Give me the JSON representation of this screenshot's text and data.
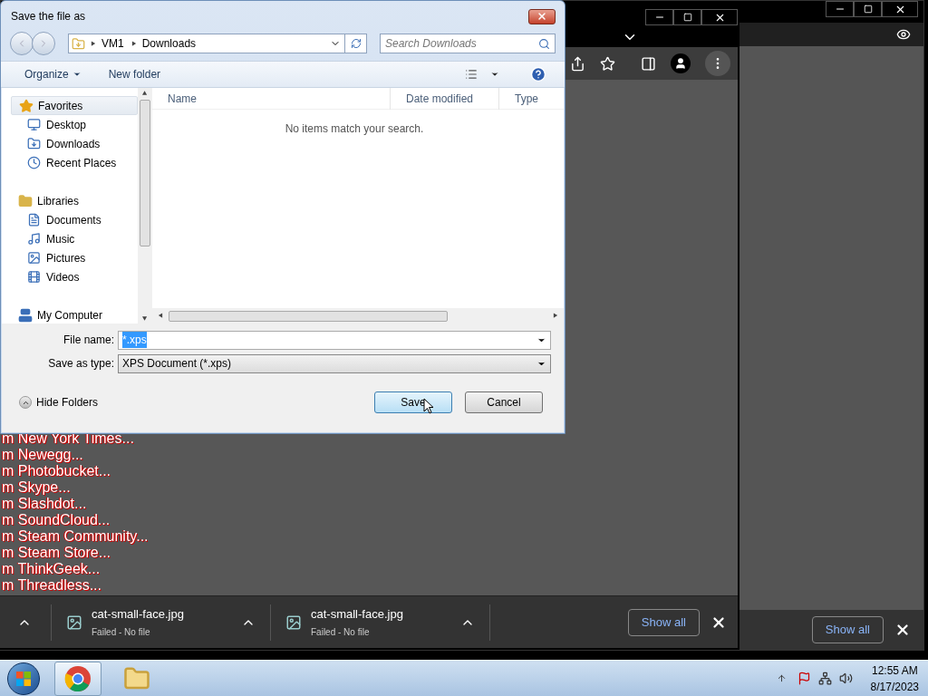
{
  "back_window": {
    "downloads_bar": {
      "show_all": "Show all"
    }
  },
  "front_window": {
    "page_lines": [
      "m New York Times...",
      "m Newegg...",
      "m Photobucket...",
      "m Skype...",
      "m Slashdot...",
      "m SoundCloud...",
      "m Steam Community...",
      "m Steam Store...",
      "m ThinkGeek...",
      "m Threadless..."
    ],
    "downloads": [
      {
        "name": "cat-small-face.jpg",
        "status": "Failed - No file"
      },
      {
        "name": "cat-small-face.jpg",
        "status": "Failed - No file"
      }
    ],
    "show_all": "Show all"
  },
  "dialog": {
    "title": "Save the file as",
    "path": [
      "VM1",
      "Downloads"
    ],
    "search": {
      "placeholder": "Search Downloads"
    },
    "toolbar": [
      "Organize",
      "New folder"
    ],
    "sidebar": [
      {
        "label": "Favorites",
        "selected": true,
        "children": [
          {
            "label": "Desktop"
          },
          {
            "label": "Downloads"
          },
          {
            "label": "Recent Places"
          }
        ]
      },
      {
        "label": "Libraries",
        "selected": false,
        "children": [
          {
            "label": "Documents"
          },
          {
            "label": "Music"
          },
          {
            "label": "Pictures"
          },
          {
            "label": "Videos"
          }
        ]
      },
      {
        "label": "My Computer",
        "selected": false
      }
    ],
    "columns": [
      "Name",
      "Date modified",
      "Type"
    ],
    "empty_message": "No items match your search.",
    "file_name": {
      "label": "File name:",
      "value": "*.xps",
      "selected": true
    },
    "save_type": {
      "label": "Save as type:",
      "value": "XPS Document (*.xps)"
    },
    "hide_folders": "Hide Folders",
    "buttons": [
      "Save",
      "Cancel"
    ]
  },
  "taskbar": {
    "time": "12:55 AM",
    "date": "8/17/2023"
  }
}
